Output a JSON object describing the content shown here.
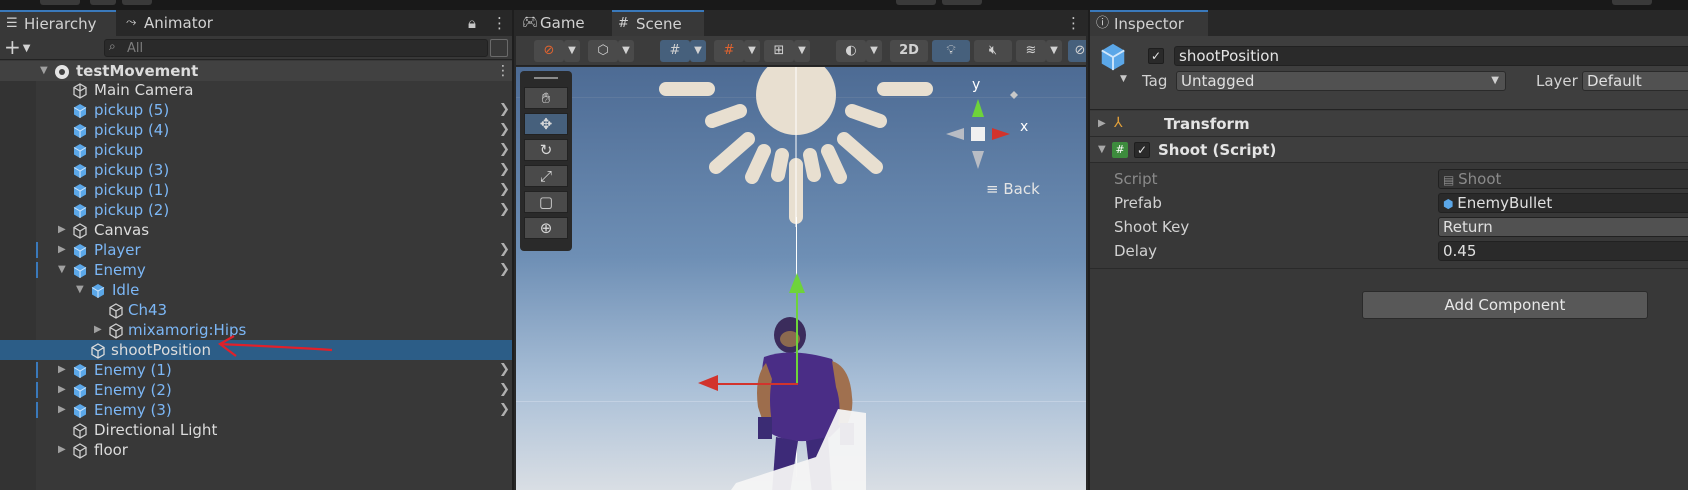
{
  "hierarchy": {
    "tabs": [
      {
        "label": "Hierarchy"
      },
      {
        "label": "Animator"
      }
    ],
    "search_placeholder": "All",
    "rows": [
      {
        "label": "testMovement"
      },
      {
        "label": "Main Camera"
      },
      {
        "label": "pickup (5)"
      },
      {
        "label": "pickup (4)"
      },
      {
        "label": "pickup"
      },
      {
        "label": "pickup (3)"
      },
      {
        "label": "pickup (1)"
      },
      {
        "label": "pickup (2)"
      },
      {
        "label": "Canvas"
      },
      {
        "label": "Player"
      },
      {
        "label": "Enemy"
      },
      {
        "label": "Idle"
      },
      {
        "label": "Ch43"
      },
      {
        "label": "mixamorig:Hips"
      },
      {
        "label": "shootPosition"
      },
      {
        "label": "Enemy (1)"
      },
      {
        "label": "Enemy (2)"
      },
      {
        "label": "Enemy (3)"
      },
      {
        "label": "Directional Light"
      },
      {
        "label": "floor"
      }
    ]
  },
  "scene": {
    "tabs": [
      {
        "label": "Game"
      },
      {
        "label": "Scene"
      }
    ],
    "toggle_2d": "2D",
    "gizmo_y": "y",
    "gizmo_x": "x",
    "back_label": "Back"
  },
  "inspector": {
    "tab": "Inspector",
    "object_name": "shootPosition",
    "tag_label": "Tag",
    "tag_value": "Untagged",
    "layer_label": "Layer",
    "layer_value": "Default",
    "components": [
      {
        "title": "Transform"
      },
      {
        "title": "Shoot (Script)"
      }
    ],
    "fields": [
      {
        "label": "Script",
        "value": "Shoot"
      },
      {
        "label": "Prefab",
        "value": "EnemyBullet"
      },
      {
        "label": "Shoot Key",
        "value": "Return"
      },
      {
        "label": "Delay",
        "value": "0.45"
      }
    ],
    "add_component": "Add Component"
  },
  "colors": {
    "selection": "#2c5d87",
    "prefab_text": "#7cb7f6",
    "annotation_arrow": "#e0202a"
  }
}
